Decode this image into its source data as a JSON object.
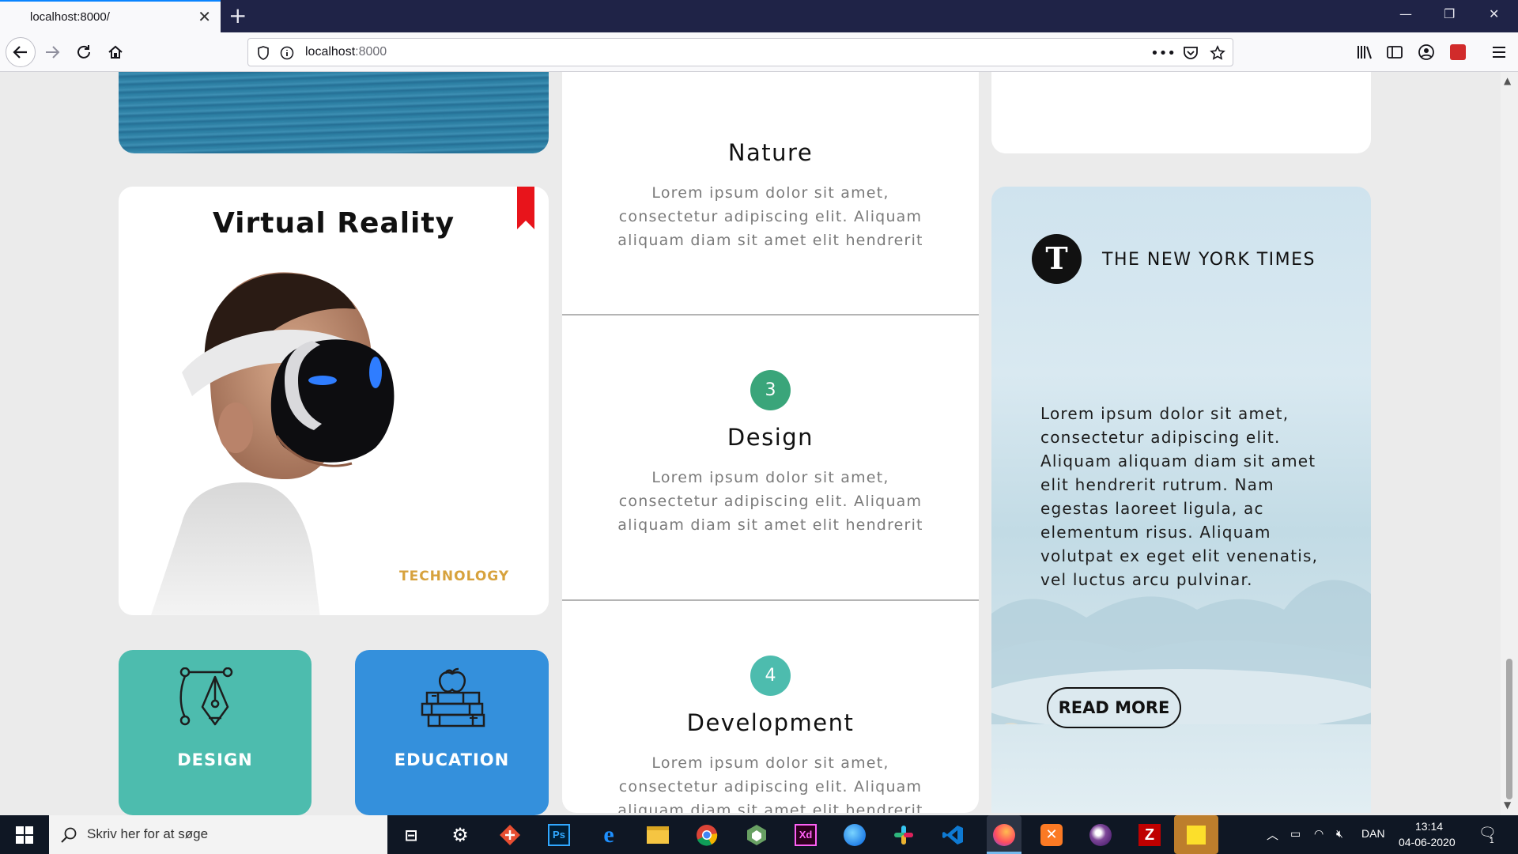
{
  "browser": {
    "tab_title": "localhost:8000/",
    "url_host": "localhost",
    "url_port": ":8000"
  },
  "vr_card": {
    "title": "Virtual Reality",
    "tag": "TECHNOLOGY"
  },
  "tiles": {
    "design_label": "DESIGN",
    "education_label": "EDUCATION"
  },
  "steps": [
    {
      "number": "",
      "title": "Nature",
      "body": "Lorem ipsum dolor sit amet, consectetur adipiscing elit. Aliquam aliquam diam sit amet elit hendrerit"
    },
    {
      "number": "3",
      "title": "Design",
      "body": "Lorem ipsum dolor sit amet, consectetur adipiscing elit. Aliquam aliquam diam sit amet elit hendrerit",
      "color": "#3aa57a"
    },
    {
      "number": "4",
      "title": "Development",
      "body": "Lorem ipsum dolor sit amet, consectetur adipiscing elit. Aliquam aliquam diam sit amet elit hendrerit",
      "color": "#4dbcae"
    }
  ],
  "nyt_card": {
    "logo_letter": "T",
    "name": "THE NEW YORK TIMES",
    "body": "Lorem ipsum dolor sit amet, consectetur adipiscing elit. Aliquam aliquam diam sit amet elit hendrerit rutrum. Nam egestas laoreet ligula, ac elementum risus. Aliquam volutpat ex eget elit venenatis, vel luctus arcu pulvinar.",
    "button": "READ MORE"
  },
  "taskbar": {
    "search_placeholder": "Skriv her for at søge",
    "language": "DAN",
    "time": "13:14",
    "date": "04-06-2020",
    "notification_count": "1",
    "apps": [
      "task-view",
      "settings",
      "git",
      "photoshop",
      "edge",
      "file-explorer",
      "chrome",
      "node",
      "xd",
      "firefox-dev",
      "slack",
      "vscode",
      "firefox",
      "xampp",
      "tor",
      "filezilla",
      "sticky-notes"
    ]
  },
  "colors": {
    "design_tile": "#4dbcae",
    "education_tile": "#3490dc",
    "technology_tag": "#d7a23d",
    "bookmark": "#e8141b"
  }
}
